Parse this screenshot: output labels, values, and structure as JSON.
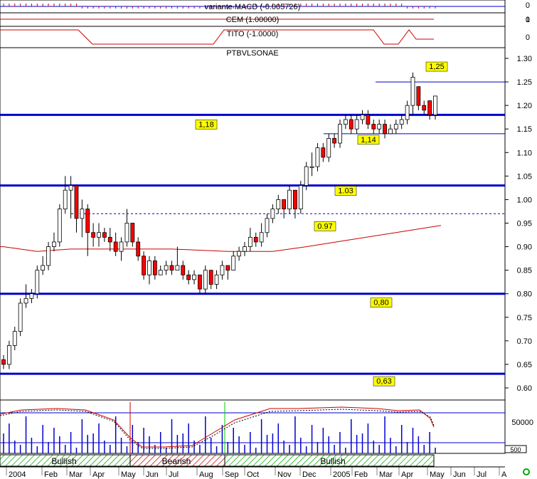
{
  "panels": {
    "macd_title": "variante MACD (-0.005726)",
    "cem_title": "CEM (1.00000)",
    "tito_title": "TITO (-1.0000)",
    "main_title": "PTBVLSONAE",
    "macd_axis": [
      "0",
      "0"
    ],
    "cem_axis": [
      "1"
    ],
    "tito_axis": [
      "0"
    ],
    "volume_axis": "50000",
    "corner_label": "500"
  },
  "trend_bands": [
    {
      "label": "Bullish",
      "kind": "bullish"
    },
    {
      "label": "Bearish",
      "kind": "bearish"
    },
    {
      "label": "Bullish",
      "kind": "bullish"
    }
  ],
  "colors": {
    "up_body": "#ffffff",
    "down_body": "#ff0000",
    "level_line": "#0000cc",
    "moving_average": "#cc0000",
    "label_bg": "#ffff00",
    "bullish_hatch": "#00aa00",
    "bearish_hatch": "#cc0000"
  },
  "chart_data": {
    "type": "candlestick",
    "title": "PTBVLSONAE",
    "ylim": [
      0.6,
      1.3
    ],
    "yticks": [
      "0.60",
      "0.65",
      "0.70",
      "0.75",
      "0.80",
      "0.85",
      "0.90",
      "0.95",
      "1.00",
      "1.05",
      "1.10",
      "1.15",
      "1.20",
      "1.25",
      "1.30"
    ],
    "x_labels": [
      "2004",
      "Feb",
      "Mar",
      "Apr",
      "May",
      "Jun",
      "Jul",
      "Aug",
      "Sep",
      "Oct",
      "Nov",
      "Dec",
      "2005",
      "Feb",
      "Mar",
      "Apr",
      "May",
      "Jun",
      "Jul",
      "A"
    ],
    "levels": [
      {
        "value": 1.18,
        "label": "1,18",
        "style": "solid"
      },
      {
        "value": 1.03,
        "label": "1.03",
        "style": "solid"
      },
      {
        "value": 0.8,
        "label": "0,80",
        "style": "solid"
      },
      {
        "value": 0.63,
        "label": "0,63",
        "style": "solid"
      },
      {
        "value": 0.97,
        "label": "0.97",
        "style": "dotted"
      },
      {
        "value": 1.25,
        "label": "1,25",
        "style": "thin"
      },
      {
        "value": 1.14,
        "label": "1,14",
        "style": "thin"
      }
    ],
    "candles": [
      [
        0.66,
        0.65,
        0.67,
        0.64
      ],
      [
        0.65,
        0.69,
        0.7,
        0.64
      ],
      [
        0.69,
        0.72,
        0.73,
        0.68
      ],
      [
        0.72,
        0.78,
        0.79,
        0.71
      ],
      [
        0.78,
        0.79,
        0.82,
        0.77
      ],
      [
        0.79,
        0.8,
        0.81,
        0.78
      ],
      [
        0.8,
        0.85,
        0.86,
        0.79
      ],
      [
        0.85,
        0.86,
        0.88,
        0.84
      ],
      [
        0.86,
        0.9,
        0.91,
        0.85
      ],
      [
        0.9,
        0.91,
        0.93,
        0.89
      ],
      [
        0.91,
        0.98,
        0.99,
        0.9
      ],
      [
        0.98,
        1.02,
        1.05,
        0.97
      ],
      [
        1.02,
        1.03,
        1.05,
        0.96
      ],
      [
        1.03,
        0.96,
        1.03,
        0.93
      ],
      [
        0.96,
        0.98,
        1.0,
        0.92
      ],
      [
        0.98,
        0.93,
        0.99,
        0.88
      ],
      [
        0.93,
        0.92,
        0.95,
        0.9
      ],
      [
        0.92,
        0.93,
        0.95,
        0.9
      ],
      [
        0.93,
        0.92,
        0.94,
        0.91
      ],
      [
        0.92,
        0.91,
        0.94,
        0.89
      ],
      [
        0.91,
        0.89,
        0.93,
        0.88
      ],
      [
        0.89,
        0.91,
        0.92,
        0.87
      ],
      [
        0.91,
        0.95,
        0.98,
        0.9
      ],
      [
        0.95,
        0.91,
        0.95,
        0.9
      ],
      [
        0.91,
        0.88,
        0.92,
        0.87
      ],
      [
        0.88,
        0.84,
        0.89,
        0.83
      ],
      [
        0.84,
        0.87,
        0.88,
        0.82
      ],
      [
        0.87,
        0.84,
        0.88,
        0.83
      ],
      [
        0.84,
        0.85,
        0.86,
        0.84
      ],
      [
        0.85,
        0.86,
        0.87,
        0.84
      ],
      [
        0.86,
        0.85,
        0.87,
        0.84
      ],
      [
        0.85,
        0.86,
        0.9,
        0.85
      ],
      [
        0.86,
        0.84,
        0.87,
        0.83
      ],
      [
        0.84,
        0.83,
        0.85,
        0.82
      ],
      [
        0.83,
        0.84,
        0.85,
        0.82
      ],
      [
        0.84,
        0.81,
        0.84,
        0.8
      ],
      [
        0.81,
        0.85,
        0.86,
        0.8
      ],
      [
        0.85,
        0.82,
        0.85,
        0.81
      ],
      [
        0.82,
        0.84,
        0.85,
        0.81
      ],
      [
        0.84,
        0.86,
        0.87,
        0.83
      ],
      [
        0.86,
        0.85,
        0.86,
        0.83
      ],
      [
        0.85,
        0.88,
        0.89,
        0.85
      ],
      [
        0.88,
        0.89,
        0.9,
        0.87
      ],
      [
        0.89,
        0.9,
        0.91,
        0.88
      ],
      [
        0.9,
        0.92,
        0.94,
        0.89
      ],
      [
        0.92,
        0.91,
        0.93,
        0.9
      ],
      [
        0.91,
        0.93,
        0.95,
        0.9
      ],
      [
        0.93,
        0.96,
        0.97,
        0.92
      ],
      [
        0.96,
        0.98,
        0.99,
        0.95
      ],
      [
        0.98,
        1.0,
        1.01,
        0.97
      ],
      [
        1.0,
        0.98,
        1.0,
        0.96
      ],
      [
        0.98,
        1.02,
        1.03,
        0.97
      ],
      [
        1.02,
        0.98,
        1.02,
        0.96
      ],
      [
        0.98,
        1.03,
        1.04,
        0.97
      ],
      [
        1.03,
        1.07,
        1.08,
        1.02
      ],
      [
        1.07,
        1.07,
        1.1,
        1.05
      ],
      [
        1.07,
        1.11,
        1.12,
        1.06
      ],
      [
        1.11,
        1.09,
        1.12,
        1.08
      ],
      [
        1.09,
        1.13,
        1.14,
        1.08
      ],
      [
        1.13,
        1.12,
        1.14,
        1.11
      ],
      [
        1.12,
        1.16,
        1.17,
        1.11
      ],
      [
        1.16,
        1.17,
        1.18,
        1.15
      ],
      [
        1.17,
        1.15,
        1.18,
        1.14
      ],
      [
        1.15,
        1.17,
        1.18,
        1.14
      ],
      [
        1.17,
        1.18,
        1.19,
        1.16
      ],
      [
        1.18,
        1.16,
        1.19,
        1.15
      ],
      [
        1.16,
        1.15,
        1.17,
        1.14
      ],
      [
        1.15,
        1.16,
        1.17,
        1.14
      ],
      [
        1.16,
        1.14,
        1.17,
        1.13
      ],
      [
        1.14,
        1.15,
        1.16,
        1.14
      ],
      [
        1.15,
        1.16,
        1.17,
        1.14
      ],
      [
        1.16,
        1.17,
        1.18,
        1.15
      ],
      [
        1.17,
        1.2,
        1.21,
        1.16
      ],
      [
        1.2,
        1.26,
        1.27,
        1.18
      ],
      [
        1.24,
        1.2,
        1.24,
        1.19
      ],
      [
        1.2,
        1.19,
        1.21,
        1.18
      ],
      [
        1.21,
        1.18,
        1.21,
        1.17
      ],
      [
        1.18,
        1.22,
        1.22,
        1.17
      ]
    ],
    "moving_average": [
      {
        "i": 0,
        "v": 0.9
      },
      {
        "i": 6,
        "v": 0.89
      },
      {
        "i": 12,
        "v": 0.895
      },
      {
        "i": 20,
        "v": 0.895
      },
      {
        "i": 30,
        "v": 0.895
      },
      {
        "i": 40,
        "v": 0.89
      },
      {
        "i": 48,
        "v": 0.89
      },
      {
        "i": 54,
        "v": 0.9
      },
      {
        "i": 62,
        "v": 0.915
      },
      {
        "i": 70,
        "v": 0.93
      },
      {
        "i": 78,
        "v": 0.945
      }
    ]
  }
}
